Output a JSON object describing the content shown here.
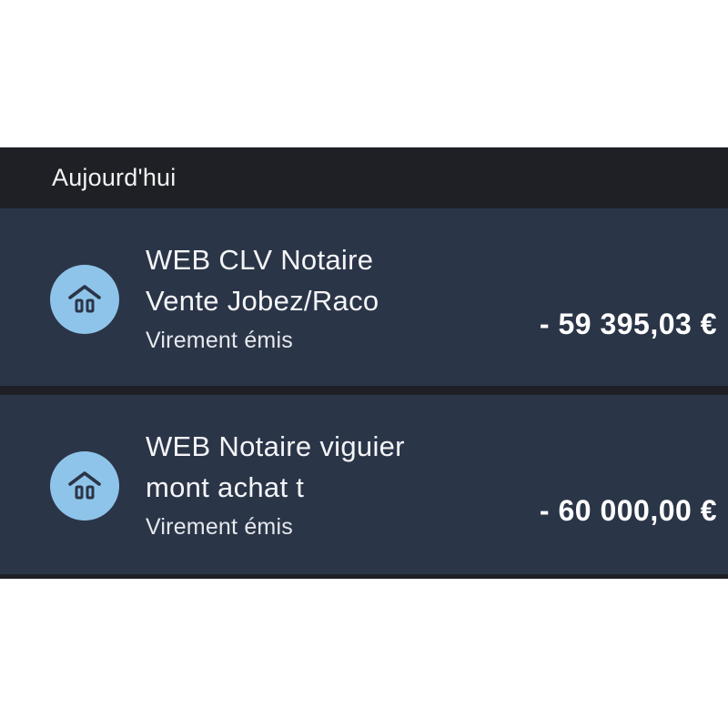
{
  "section": {
    "title": "Aujourd'hui"
  },
  "transactions": [
    {
      "icon": "home-icon",
      "line1": "WEB CLV Notaire",
      "line2": "Vente Jobez/Raco",
      "type": "Virement émis",
      "amount": "- 59 395,03 €"
    },
    {
      "icon": "home-icon",
      "line1": "WEB Notaire viguier",
      "line2": "mont achat t",
      "type": "Virement émis",
      "amount": "- 60 000,00 €"
    }
  ],
  "colors": {
    "header_bg": "#1e2026",
    "row_bg": "#2b3548",
    "icon_bg": "#8fc4ea",
    "icon_fg": "#2b3548",
    "text": "#ffffff"
  }
}
